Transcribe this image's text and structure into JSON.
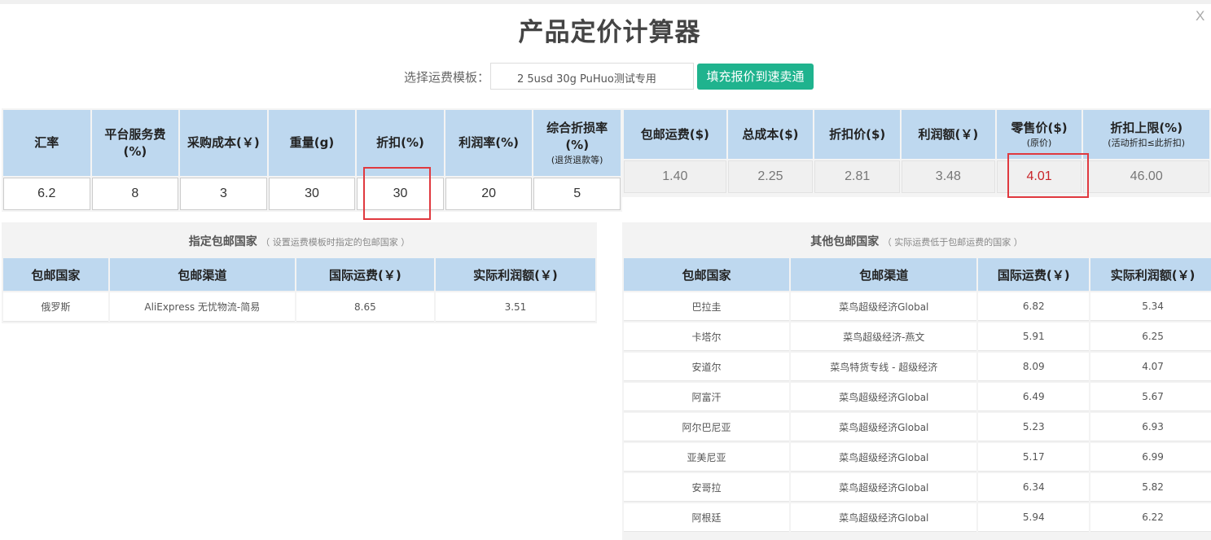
{
  "window": {
    "title": "产品定价计算器",
    "close_label": "X"
  },
  "template": {
    "label": "选择运费模板：",
    "value": "2 5usd 30g PuHuo测试专用",
    "fill_button": "填充报价到速卖通"
  },
  "inputs": {
    "headers": [
      {
        "main": "汇率",
        "sub": ""
      },
      {
        "main": "平台服务费(%)",
        "sub": ""
      },
      {
        "main": "采购成本(￥)",
        "sub": ""
      },
      {
        "main": "重量(g)",
        "sub": ""
      },
      {
        "main": "折扣(%)",
        "sub": ""
      },
      {
        "main": "利润率(%)",
        "sub": ""
      },
      {
        "main": "综合折损率(%)",
        "sub": "(退货退款等)"
      }
    ],
    "values": [
      "6.2",
      "8",
      "3",
      "30",
      "30",
      "20",
      "5"
    ]
  },
  "results": {
    "headers": [
      {
        "main": "包邮运费($)",
        "sub": ""
      },
      {
        "main": "总成本($)",
        "sub": ""
      },
      {
        "main": "折扣价($)",
        "sub": ""
      },
      {
        "main": "利润额(￥)",
        "sub": ""
      },
      {
        "main": "零售价($)",
        "sub": "(原价)"
      },
      {
        "main": "折扣上限(%)",
        "sub": "(活动折扣≤此折扣)"
      }
    ],
    "values": [
      "1.40",
      "2.25",
      "2.81",
      "3.48",
      "4.01",
      "46.00"
    ],
    "highlight_color": "#c9252a"
  },
  "designated": {
    "title": "指定包邮国家",
    "note": "（ 设置运费模板时指定的包邮国家 ）",
    "columns": [
      "包邮国家",
      "包邮渠道",
      "国际运费(￥)",
      "实际利润额(￥)"
    ],
    "rows": [
      [
        "俄罗斯",
        "AliExpress 无忧物流-简易",
        "8.65",
        "3.51"
      ]
    ]
  },
  "others": {
    "title": "其他包邮国家",
    "note": "（ 实际运费低于包邮运费的国家 ）",
    "columns": [
      "包邮国家",
      "包邮渠道",
      "国际运费(￥)",
      "实际利润额(￥)"
    ],
    "rows": [
      [
        "巴拉圭",
        "菜鸟超级经济Global",
        "6.82",
        "5.34"
      ],
      [
        "卡塔尔",
        "菜鸟超级经济-燕文",
        "5.91",
        "6.25"
      ],
      [
        "安道尔",
        "菜鸟特货专线 - 超级经济",
        "8.09",
        "4.07"
      ],
      [
        "阿富汗",
        "菜鸟超级经济Global",
        "6.49",
        "5.67"
      ],
      [
        "阿尔巴尼亚",
        "菜鸟超级经济Global",
        "5.23",
        "6.93"
      ],
      [
        "亚美尼亚",
        "菜鸟超级经济Global",
        "5.17",
        "6.99"
      ],
      [
        "安哥拉",
        "菜鸟超级经济Global",
        "6.34",
        "5.82"
      ],
      [
        "阿根廷",
        "菜鸟超级经济Global",
        "5.94",
        "6.22"
      ]
    ]
  },
  "colors": {
    "accent_button": "#1fb38e",
    "header_blue": "#bed8ef",
    "highlight_box": "#e0393f"
  }
}
